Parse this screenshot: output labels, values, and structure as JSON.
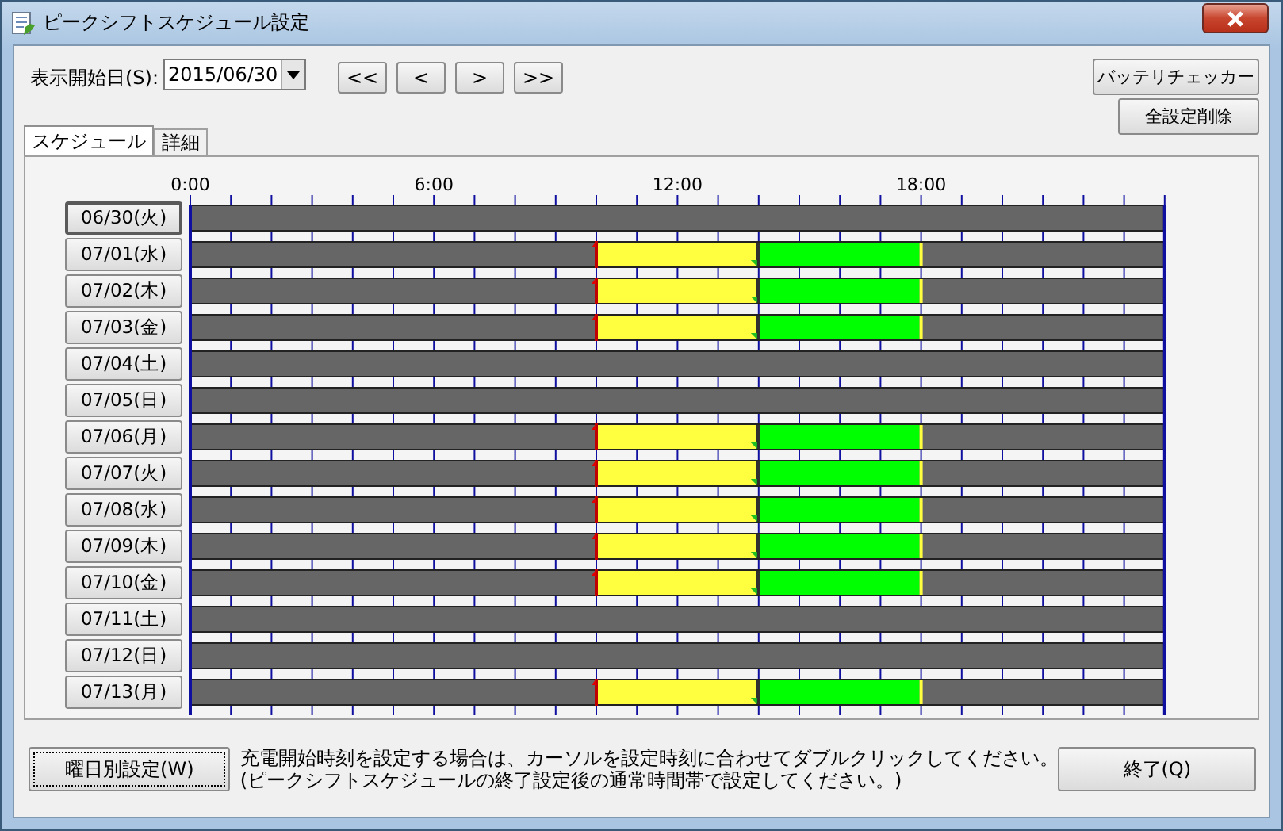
{
  "window": {
    "title": "ピークシフトスケジュール設定"
  },
  "toolbar": {
    "start_label": "表示開始日(S):",
    "start_date": "2015/06/30",
    "nav_buttons": [
      "<<",
      "<",
      ">",
      ">>"
    ],
    "side_buttons": [
      "バッテリチェッカー",
      "全設定削除"
    ]
  },
  "tabs": [
    {
      "label": "スケジュール",
      "selected": true
    },
    {
      "label": "詳細",
      "selected": false
    }
  ],
  "timeline": {
    "axis_labels": [
      "0:00",
      "6:00",
      "12:00",
      "18:00"
    ],
    "rows": [
      {
        "date": "06/30(火)",
        "focused": true,
        "hours": [
          {
            "kind": "off"
          },
          {
            "kind": "off"
          },
          {
            "kind": "off"
          },
          {
            "kind": "off"
          },
          {
            "kind": "off"
          },
          {
            "kind": "off"
          },
          {
            "kind": "off"
          },
          {
            "kind": "off"
          },
          {
            "kind": "off"
          },
          {
            "kind": "off"
          },
          {
            "kind": "off"
          },
          {
            "kind": "off"
          },
          {
            "kind": "off"
          },
          {
            "kind": "off"
          },
          {
            "kind": "off"
          },
          {
            "kind": "off"
          },
          {
            "kind": "off"
          },
          {
            "kind": "off"
          },
          {
            "kind": "off"
          },
          {
            "kind": "off"
          },
          {
            "kind": "off"
          },
          {
            "kind": "off"
          },
          {
            "kind": "off"
          },
          {
            "kind": "off"
          }
        ]
      },
      {
        "date": "07/01(水)",
        "focused": false,
        "hours": [
          {
            "kind": "off"
          },
          {
            "kind": "off"
          },
          {
            "kind": "off"
          },
          {
            "kind": "off"
          },
          {
            "kind": "off"
          },
          {
            "kind": "off"
          },
          {
            "kind": "off"
          },
          {
            "kind": "off"
          },
          {
            "kind": "off"
          },
          {
            "kind": "off"
          },
          {
            "kind": "charge"
          },
          {
            "kind": "charge"
          },
          {
            "kind": "charge"
          },
          {
            "kind": "charge"
          },
          {
            "kind": "peak"
          },
          {
            "kind": "peak"
          },
          {
            "kind": "peak"
          },
          {
            "kind": "peak"
          },
          {
            "kind": "off"
          },
          {
            "kind": "off"
          },
          {
            "kind": "off"
          },
          {
            "kind": "off"
          },
          {
            "kind": "off"
          },
          {
            "kind": "off"
          }
        ]
      },
      {
        "date": "07/02(木)",
        "focused": false,
        "hours": [
          {
            "kind": "off"
          },
          {
            "kind": "off"
          },
          {
            "kind": "off"
          },
          {
            "kind": "off"
          },
          {
            "kind": "off"
          },
          {
            "kind": "off"
          },
          {
            "kind": "off"
          },
          {
            "kind": "off"
          },
          {
            "kind": "off"
          },
          {
            "kind": "off"
          },
          {
            "kind": "charge"
          },
          {
            "kind": "charge"
          },
          {
            "kind": "charge"
          },
          {
            "kind": "charge"
          },
          {
            "kind": "peak"
          },
          {
            "kind": "peak"
          },
          {
            "kind": "peak"
          },
          {
            "kind": "peak"
          },
          {
            "kind": "off"
          },
          {
            "kind": "off"
          },
          {
            "kind": "off"
          },
          {
            "kind": "off"
          },
          {
            "kind": "off"
          },
          {
            "kind": "off"
          }
        ]
      },
      {
        "date": "07/03(金)",
        "focused": false,
        "hours": [
          {
            "kind": "off"
          },
          {
            "kind": "off"
          },
          {
            "kind": "off"
          },
          {
            "kind": "off"
          },
          {
            "kind": "off"
          },
          {
            "kind": "off"
          },
          {
            "kind": "off"
          },
          {
            "kind": "off"
          },
          {
            "kind": "off"
          },
          {
            "kind": "off"
          },
          {
            "kind": "charge"
          },
          {
            "kind": "charge"
          },
          {
            "kind": "charge"
          },
          {
            "kind": "charge"
          },
          {
            "kind": "peak"
          },
          {
            "kind": "peak"
          },
          {
            "kind": "peak"
          },
          {
            "kind": "peak"
          },
          {
            "kind": "off"
          },
          {
            "kind": "off"
          },
          {
            "kind": "off"
          },
          {
            "kind": "off"
          },
          {
            "kind": "off"
          },
          {
            "kind": "off"
          }
        ]
      },
      {
        "date": "07/04(土)",
        "focused": false,
        "hours": [
          {
            "kind": "off"
          },
          {
            "kind": "off"
          },
          {
            "kind": "off"
          },
          {
            "kind": "off"
          },
          {
            "kind": "off"
          },
          {
            "kind": "off"
          },
          {
            "kind": "off"
          },
          {
            "kind": "off"
          },
          {
            "kind": "off"
          },
          {
            "kind": "off"
          },
          {
            "kind": "off"
          },
          {
            "kind": "off"
          },
          {
            "kind": "off"
          },
          {
            "kind": "off"
          },
          {
            "kind": "off"
          },
          {
            "kind": "off"
          },
          {
            "kind": "off"
          },
          {
            "kind": "off"
          },
          {
            "kind": "off"
          },
          {
            "kind": "off"
          },
          {
            "kind": "off"
          },
          {
            "kind": "off"
          },
          {
            "kind": "off"
          },
          {
            "kind": "off"
          }
        ]
      },
      {
        "date": "07/05(日)",
        "focused": false,
        "hours": [
          {
            "kind": "off"
          },
          {
            "kind": "off"
          },
          {
            "kind": "off"
          },
          {
            "kind": "off"
          },
          {
            "kind": "off"
          },
          {
            "kind": "off"
          },
          {
            "kind": "off"
          },
          {
            "kind": "off"
          },
          {
            "kind": "off"
          },
          {
            "kind": "off"
          },
          {
            "kind": "off"
          },
          {
            "kind": "off"
          },
          {
            "kind": "off"
          },
          {
            "kind": "off"
          },
          {
            "kind": "off"
          },
          {
            "kind": "off"
          },
          {
            "kind": "off"
          },
          {
            "kind": "off"
          },
          {
            "kind": "off"
          },
          {
            "kind": "off"
          },
          {
            "kind": "off"
          },
          {
            "kind": "off"
          },
          {
            "kind": "off"
          },
          {
            "kind": "off"
          }
        ]
      },
      {
        "date": "07/06(月)",
        "focused": false,
        "hours": [
          {
            "kind": "off"
          },
          {
            "kind": "off"
          },
          {
            "kind": "off"
          },
          {
            "kind": "off"
          },
          {
            "kind": "off"
          },
          {
            "kind": "off"
          },
          {
            "kind": "off"
          },
          {
            "kind": "off"
          },
          {
            "kind": "off"
          },
          {
            "kind": "off"
          },
          {
            "kind": "charge"
          },
          {
            "kind": "charge"
          },
          {
            "kind": "charge"
          },
          {
            "kind": "charge"
          },
          {
            "kind": "peak"
          },
          {
            "kind": "peak"
          },
          {
            "kind": "peak"
          },
          {
            "kind": "peak"
          },
          {
            "kind": "off"
          },
          {
            "kind": "off"
          },
          {
            "kind": "off"
          },
          {
            "kind": "off"
          },
          {
            "kind": "off"
          },
          {
            "kind": "off"
          }
        ]
      },
      {
        "date": "07/07(火)",
        "focused": false,
        "hours": [
          {
            "kind": "off"
          },
          {
            "kind": "off"
          },
          {
            "kind": "off"
          },
          {
            "kind": "off"
          },
          {
            "kind": "off"
          },
          {
            "kind": "off"
          },
          {
            "kind": "off"
          },
          {
            "kind": "off"
          },
          {
            "kind": "off"
          },
          {
            "kind": "off"
          },
          {
            "kind": "charge"
          },
          {
            "kind": "charge"
          },
          {
            "kind": "charge"
          },
          {
            "kind": "charge"
          },
          {
            "kind": "peak"
          },
          {
            "kind": "peak"
          },
          {
            "kind": "peak"
          },
          {
            "kind": "peak"
          },
          {
            "kind": "off"
          },
          {
            "kind": "off"
          },
          {
            "kind": "off"
          },
          {
            "kind": "off"
          },
          {
            "kind": "off"
          },
          {
            "kind": "off"
          }
        ]
      },
      {
        "date": "07/08(水)",
        "focused": false,
        "hours": [
          {
            "kind": "off"
          },
          {
            "kind": "off"
          },
          {
            "kind": "off"
          },
          {
            "kind": "off"
          },
          {
            "kind": "off"
          },
          {
            "kind": "off"
          },
          {
            "kind": "off"
          },
          {
            "kind": "off"
          },
          {
            "kind": "off"
          },
          {
            "kind": "off"
          },
          {
            "kind": "charge"
          },
          {
            "kind": "charge"
          },
          {
            "kind": "charge"
          },
          {
            "kind": "charge"
          },
          {
            "kind": "peak"
          },
          {
            "kind": "peak"
          },
          {
            "kind": "peak"
          },
          {
            "kind": "peak"
          },
          {
            "kind": "off"
          },
          {
            "kind": "off"
          },
          {
            "kind": "off"
          },
          {
            "kind": "off"
          },
          {
            "kind": "off"
          },
          {
            "kind": "off"
          }
        ]
      },
      {
        "date": "07/09(木)",
        "focused": false,
        "hours": [
          {
            "kind": "off"
          },
          {
            "kind": "off"
          },
          {
            "kind": "off"
          },
          {
            "kind": "off"
          },
          {
            "kind": "off"
          },
          {
            "kind": "off"
          },
          {
            "kind": "off"
          },
          {
            "kind": "off"
          },
          {
            "kind": "off"
          },
          {
            "kind": "off"
          },
          {
            "kind": "charge"
          },
          {
            "kind": "charge"
          },
          {
            "kind": "charge"
          },
          {
            "kind": "charge"
          },
          {
            "kind": "peak"
          },
          {
            "kind": "peak"
          },
          {
            "kind": "peak"
          },
          {
            "kind": "peak"
          },
          {
            "kind": "off"
          },
          {
            "kind": "off"
          },
          {
            "kind": "off"
          },
          {
            "kind": "off"
          },
          {
            "kind": "off"
          },
          {
            "kind": "off"
          }
        ]
      },
      {
        "date": "07/10(金)",
        "focused": false,
        "hours": [
          {
            "kind": "off"
          },
          {
            "kind": "off"
          },
          {
            "kind": "off"
          },
          {
            "kind": "off"
          },
          {
            "kind": "off"
          },
          {
            "kind": "off"
          },
          {
            "kind": "off"
          },
          {
            "kind": "off"
          },
          {
            "kind": "off"
          },
          {
            "kind": "off"
          },
          {
            "kind": "charge"
          },
          {
            "kind": "charge"
          },
          {
            "kind": "charge"
          },
          {
            "kind": "charge"
          },
          {
            "kind": "peak"
          },
          {
            "kind": "peak"
          },
          {
            "kind": "peak"
          },
          {
            "kind": "peak"
          },
          {
            "kind": "off"
          },
          {
            "kind": "off"
          },
          {
            "kind": "off"
          },
          {
            "kind": "off"
          },
          {
            "kind": "off"
          },
          {
            "kind": "off"
          }
        ]
      },
      {
        "date": "07/11(土)",
        "focused": false,
        "hours": [
          {
            "kind": "off"
          },
          {
            "kind": "off"
          },
          {
            "kind": "off"
          },
          {
            "kind": "off"
          },
          {
            "kind": "off"
          },
          {
            "kind": "off"
          },
          {
            "kind": "off"
          },
          {
            "kind": "off"
          },
          {
            "kind": "off"
          },
          {
            "kind": "off"
          },
          {
            "kind": "off"
          },
          {
            "kind": "off"
          },
          {
            "kind": "off"
          },
          {
            "kind": "off"
          },
          {
            "kind": "off"
          },
          {
            "kind": "off"
          },
          {
            "kind": "off"
          },
          {
            "kind": "off"
          },
          {
            "kind": "off"
          },
          {
            "kind": "off"
          },
          {
            "kind": "off"
          },
          {
            "kind": "off"
          },
          {
            "kind": "off"
          },
          {
            "kind": "off"
          }
        ]
      },
      {
        "date": "07/12(日)",
        "focused": false,
        "hours": [
          {
            "kind": "off"
          },
          {
            "kind": "off"
          },
          {
            "kind": "off"
          },
          {
            "kind": "off"
          },
          {
            "kind": "off"
          },
          {
            "kind": "off"
          },
          {
            "kind": "off"
          },
          {
            "kind": "off"
          },
          {
            "kind": "off"
          },
          {
            "kind": "off"
          },
          {
            "kind": "off"
          },
          {
            "kind": "off"
          },
          {
            "kind": "off"
          },
          {
            "kind": "off"
          },
          {
            "kind": "off"
          },
          {
            "kind": "off"
          },
          {
            "kind": "off"
          },
          {
            "kind": "off"
          },
          {
            "kind": "off"
          },
          {
            "kind": "off"
          },
          {
            "kind": "off"
          },
          {
            "kind": "off"
          },
          {
            "kind": "off"
          },
          {
            "kind": "off"
          }
        ]
      },
      {
        "date": "07/13(月)",
        "focused": false,
        "hours": [
          {
            "kind": "off"
          },
          {
            "kind": "off"
          },
          {
            "kind": "off"
          },
          {
            "kind": "off"
          },
          {
            "kind": "off"
          },
          {
            "kind": "off"
          },
          {
            "kind": "off"
          },
          {
            "kind": "off"
          },
          {
            "kind": "off"
          },
          {
            "kind": "off"
          },
          {
            "kind": "charge"
          },
          {
            "kind": "charge"
          },
          {
            "kind": "charge"
          },
          {
            "kind": "charge"
          },
          {
            "kind": "peak"
          },
          {
            "kind": "peak"
          },
          {
            "kind": "peak"
          },
          {
            "kind": "peak"
          },
          {
            "kind": "off"
          },
          {
            "kind": "off"
          },
          {
            "kind": "off"
          },
          {
            "kind": "off"
          },
          {
            "kind": "off"
          },
          {
            "kind": "off"
          }
        ]
      }
    ]
  },
  "footer": {
    "weekday_button": "曜日別設定(W)",
    "hint": [
      "充電開始時刻を設定する場合は、カーソルを設定時刻に合わせてダブルクリックしてください。",
      "(ピークシフトスケジュールの終了設定後の通常時間帯で設定してください。)"
    ],
    "close_button": "終了(Q)"
  }
}
